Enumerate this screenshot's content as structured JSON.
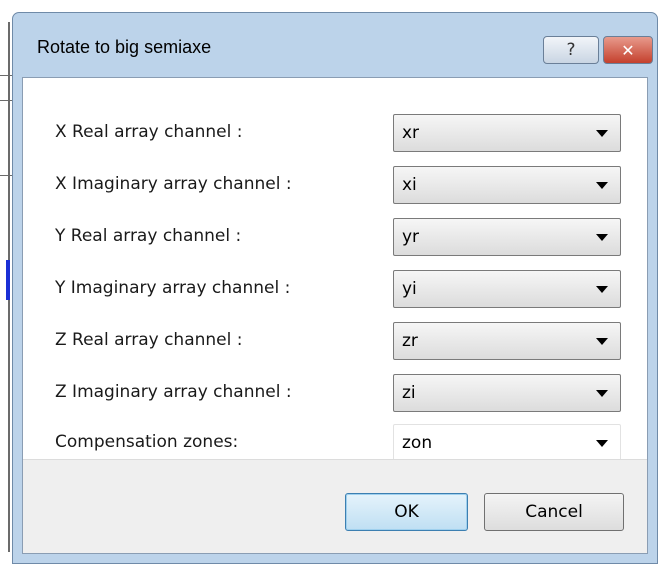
{
  "window": {
    "title": "Rotate to big semiaxe",
    "help_glyph": "?",
    "close_glyph": "✕"
  },
  "fields": [
    {
      "label": "X Real array channel :",
      "value": "xr"
    },
    {
      "label": "X Imaginary array channel :",
      "value": "xi"
    },
    {
      "label": "Y Real array channel :",
      "value": "yr"
    },
    {
      "label": "Y Imaginary array channel :",
      "value": "yi"
    },
    {
      "label": "Z Real array channel :",
      "value": "zr"
    },
    {
      "label": "Z Imaginary array channel :",
      "value": "zi"
    },
    {
      "label": "Compensation zones:",
      "value": "zon"
    }
  ],
  "buttons": {
    "ok_label": "OK",
    "cancel_label": "Cancel"
  },
  "colors": {
    "title_bar": "#bcd3ea",
    "close_button": "#c4402d",
    "default_button": "#bfdff3"
  },
  "icons": {
    "help": "help-icon",
    "close": "close-icon",
    "dropdown": "chevron-down-icon"
  }
}
